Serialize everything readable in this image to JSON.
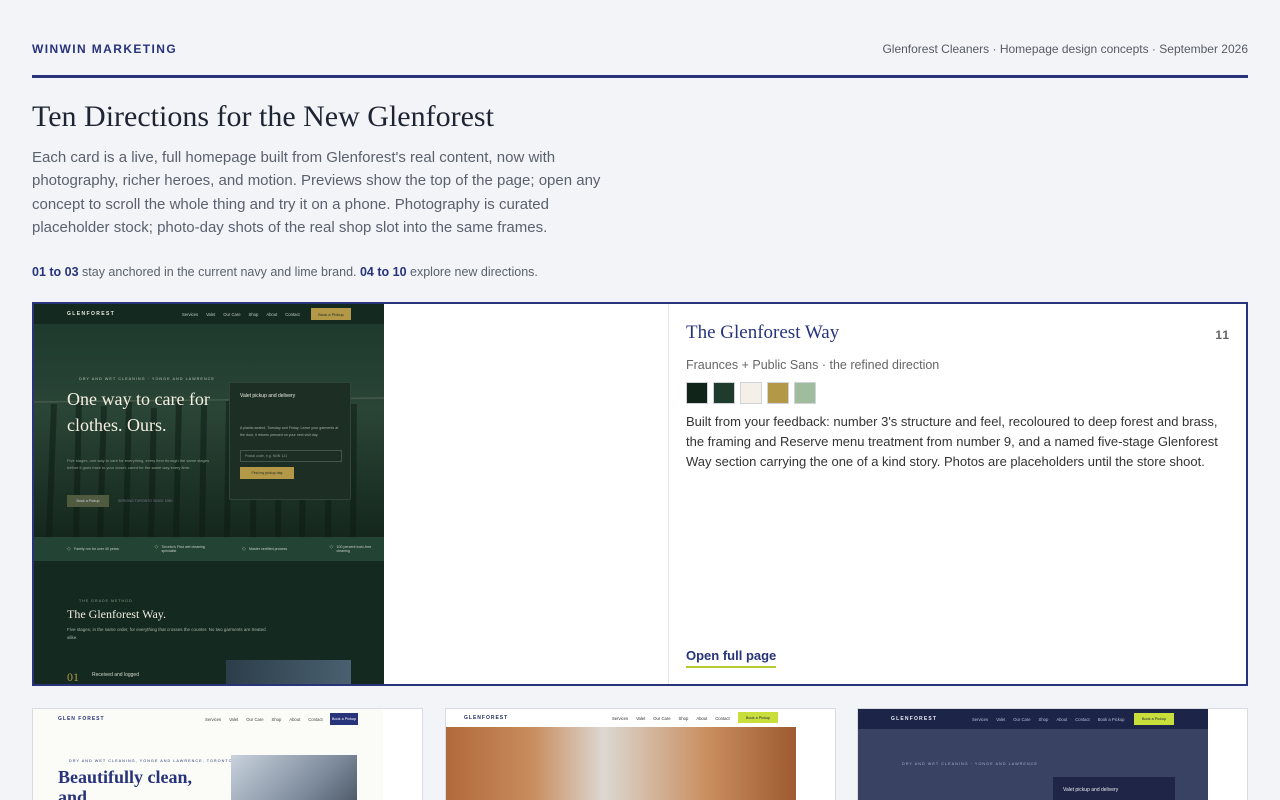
{
  "header": {
    "brand": "WINWIN MARKETING",
    "meta": "Glenforest Cleaners · Homepage design concepts · September 2026"
  },
  "page": {
    "title": "Ten Directions for the New Glenforest",
    "intro": "Each card is a live, full homepage built from Glenforest's real content, now with photography, richer heroes, and motion. Previews show the top of the page; open any concept to scroll the whole thing and try it on a phone. Photography is curated placeholder stock; photo-day shots of the real shop slot into the same frames.",
    "note_range1": "01 to 03",
    "note_text1": " stay anchored in the current navy and lime brand. ",
    "note_range2": "04 to 10",
    "note_text2": " explore new directions."
  },
  "featured": {
    "title": "The Glenforest Way",
    "number": "11",
    "fonts": "Fraunces + Public Sans · the refined direction",
    "swatches": [
      "#10241a",
      "#1f3b2d",
      "#f4f0e8",
      "#b39848",
      "#9fbc9c"
    ],
    "description": "Built from your feedback: number 3's structure and feel, recoloured to deep forest and brass, the framing and Reserve menu treatment from number 9, and a named five-stage Glenforest Way section carrying the one of a kind story. Photos are placeholders until the store shoot.",
    "open_label": "Open full page",
    "preview": {
      "logo": "GLENFOREST",
      "nav": [
        "Services",
        "Valet",
        "Our Care",
        "Shop",
        "About",
        "Contact"
      ],
      "nav_button": "Book a Pickup",
      "kicker": "DRY AND WET CLEANING · YONGE AND LAWRENCE",
      "headline": "One way to care for clothes. Ours.",
      "small_text": "Five stages, one way to care for everything, every item through the same stages before it goes back to your closet, cared for the same way every time.",
      "hero_button": "Book a Pickup",
      "rating": "SERVING TORONTO SINCE 1980",
      "form_title": "Valet pickup and delivery",
      "form_text": "A plastic-sealed, Tuesday and Friday. Leave your garments at the door, it returns pressed on your next visit day.",
      "form_placeholder": "Postal code, e.g. M4N 1J1",
      "form_button": "Find my pickup day",
      "strip": [
        "Family run for over 40 years",
        "Toronto's First wet cleaning specialist",
        "Master certified process",
        "100 percent toxic-free cleaning"
      ],
      "section_kicker": "THE GRADE METHOD",
      "section_title": "The Glenforest Way.",
      "section_text": "Five stages, in the same order, for everything that crosses the counter. No two garments are treated alike.",
      "step_number": "01",
      "step_label": "Received and logged"
    }
  },
  "cards": [
    {
      "logo": "GLEN FOREST",
      "nav": [
        "Services",
        "Valet",
        "Our Care",
        "Shop",
        "About",
        "Contact"
      ],
      "nav_button": "Book a Pickup",
      "kicker": "DRY AND WET CLEANING, YONGE AND LAWRENCE, TORONTO",
      "headline": "Beautifully clean, and"
    },
    {
      "logo": "GLENFOREST",
      "nav": [
        "Services",
        "Valet",
        "Our Care",
        "Shop",
        "About",
        "Contact"
      ],
      "nav_button": "Book a Pickup"
    },
    {
      "logo": "GLENFOREST",
      "nav": [
        "Services",
        "Valet",
        "Our Care",
        "Shop",
        "About",
        "Contact",
        "Book a Pickup"
      ],
      "nav_button": "Book a Pickup",
      "kicker": "DRY AND WET CLEANING · YONGE AND LAWRENCE",
      "panel_title": "Valet pickup and delivery"
    }
  ]
}
